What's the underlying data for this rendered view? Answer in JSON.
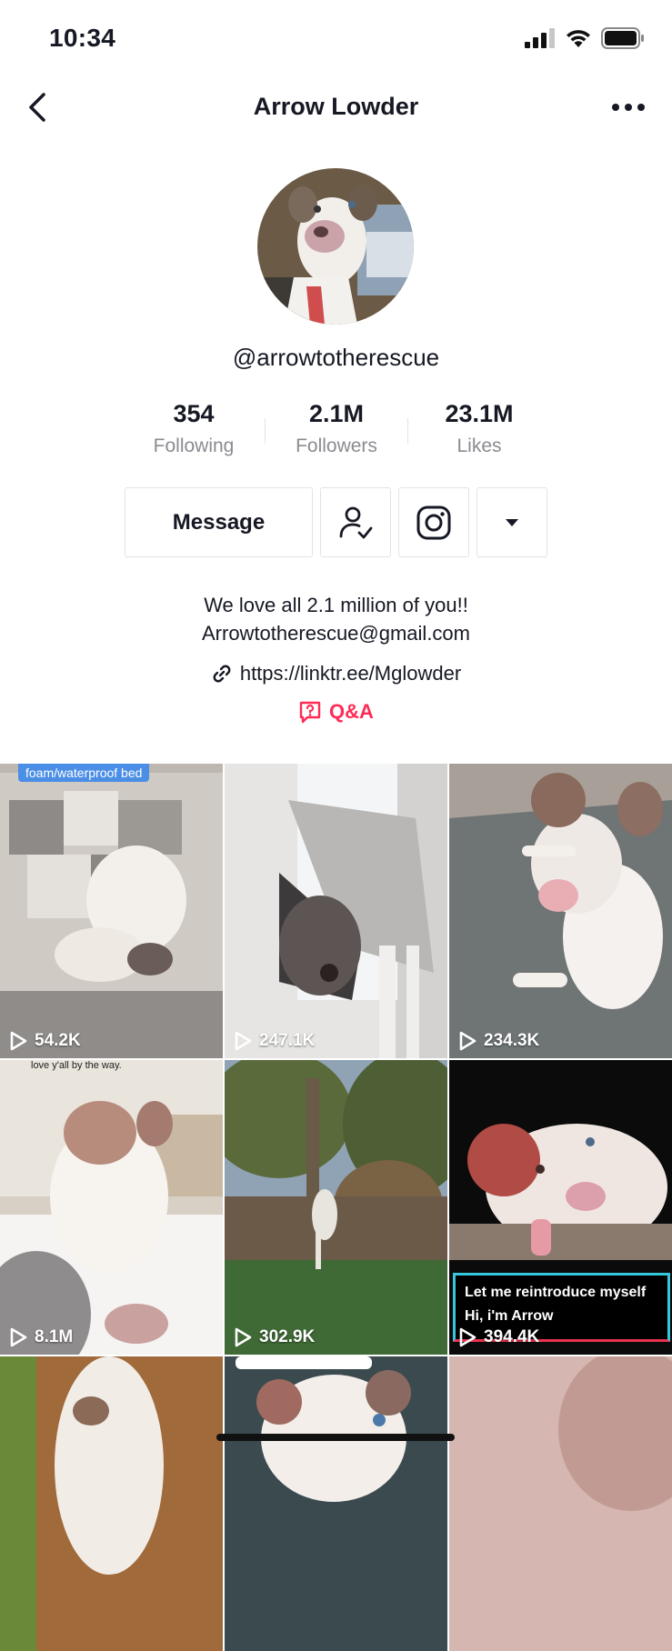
{
  "status": {
    "time": "10:34"
  },
  "header": {
    "title": "Arrow Lowder"
  },
  "profile": {
    "username": "@arrowtotherescue",
    "stats": [
      {
        "value": "354",
        "label": "Following"
      },
      {
        "value": "2.1M",
        "label": "Followers"
      },
      {
        "value": "23.1M",
        "label": "Likes"
      }
    ],
    "actions": {
      "message_label": "Message"
    },
    "bio_line1": "We love all 2.1 million of you!!",
    "bio_line2": "Arrowtotherescue@gmail.com",
    "link": "https://linktr.ee/Mglowder",
    "qa_label": "Q&A"
  },
  "videos": [
    {
      "views": "54.2K",
      "caption": "foam/waterproof bed"
    },
    {
      "views": "247.1K"
    },
    {
      "views": "234.3K"
    },
    {
      "views": "8.1M",
      "caption": "love y'all by the way."
    },
    {
      "views": "302.9K"
    },
    {
      "views": "394.4K",
      "caption_line1": "Let me reintroduce myself",
      "caption_line2": "Hi, i'm Arrow"
    }
  ],
  "colors": {
    "accent": "#fe2c55",
    "muted": "#8a8b91",
    "border": "#e3e3e4"
  }
}
